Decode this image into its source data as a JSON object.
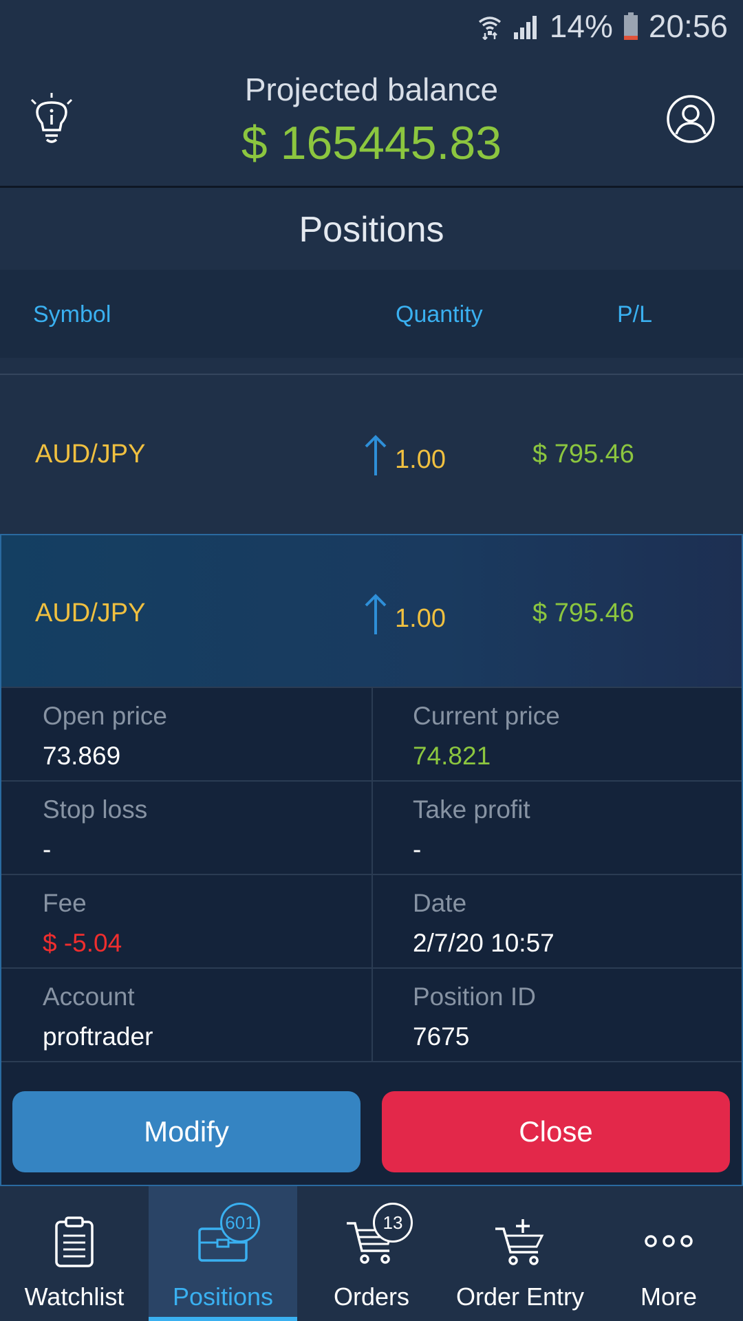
{
  "status_bar": {
    "battery": "14%",
    "time": "20:56"
  },
  "header": {
    "title": "Projected balance",
    "balance": "$ 165445.83"
  },
  "section": {
    "title": "Positions"
  },
  "columns": {
    "symbol": "Symbol",
    "quantity": "Quantity",
    "pl": "P/L"
  },
  "positions": [
    {
      "symbol": "AUD/JPY",
      "quantity": "1.00",
      "pl": "$ 795.46"
    },
    {
      "symbol": "AUD/JPY",
      "quantity": "1.00",
      "pl": "$ 795.46"
    }
  ],
  "details": {
    "open_price_label": "Open price",
    "open_price": "73.869",
    "current_price_label": "Current price",
    "current_price": "74.821",
    "stop_loss_label": "Stop loss",
    "stop_loss": "-",
    "take_profit_label": "Take profit",
    "take_profit": "-",
    "fee_label": "Fee",
    "fee": "$ -5.04",
    "date_label": "Date",
    "date": "2/7/20 10:57",
    "account_label": "Account",
    "account": "proftrader",
    "position_id_label": "Position ID",
    "position_id": "7675"
  },
  "actions": {
    "modify": "Modify",
    "close": "Close"
  },
  "nav": {
    "watchlist": "Watchlist",
    "positions": "Positions",
    "positions_badge": "601",
    "orders": "Orders",
    "orders_badge": "13",
    "order_entry": "Order Entry",
    "more": "More"
  },
  "colors": {
    "background": "#1f3048",
    "accent_blue": "#3ab0f0",
    "profit_green": "#8cc63f",
    "symbol_yellow": "#f0c040",
    "loss_red": "#ef2e2e",
    "close_button": "#e3284a",
    "modify_button": "#3584c2"
  },
  "icons": [
    "wifi-icon",
    "signal-icon",
    "battery-icon",
    "lightbulb-icon",
    "user-icon",
    "up-arrow-icon",
    "clipboard-icon",
    "briefcase-icon",
    "cart-icon",
    "cart-plus-icon",
    "more-dots-icon"
  ]
}
